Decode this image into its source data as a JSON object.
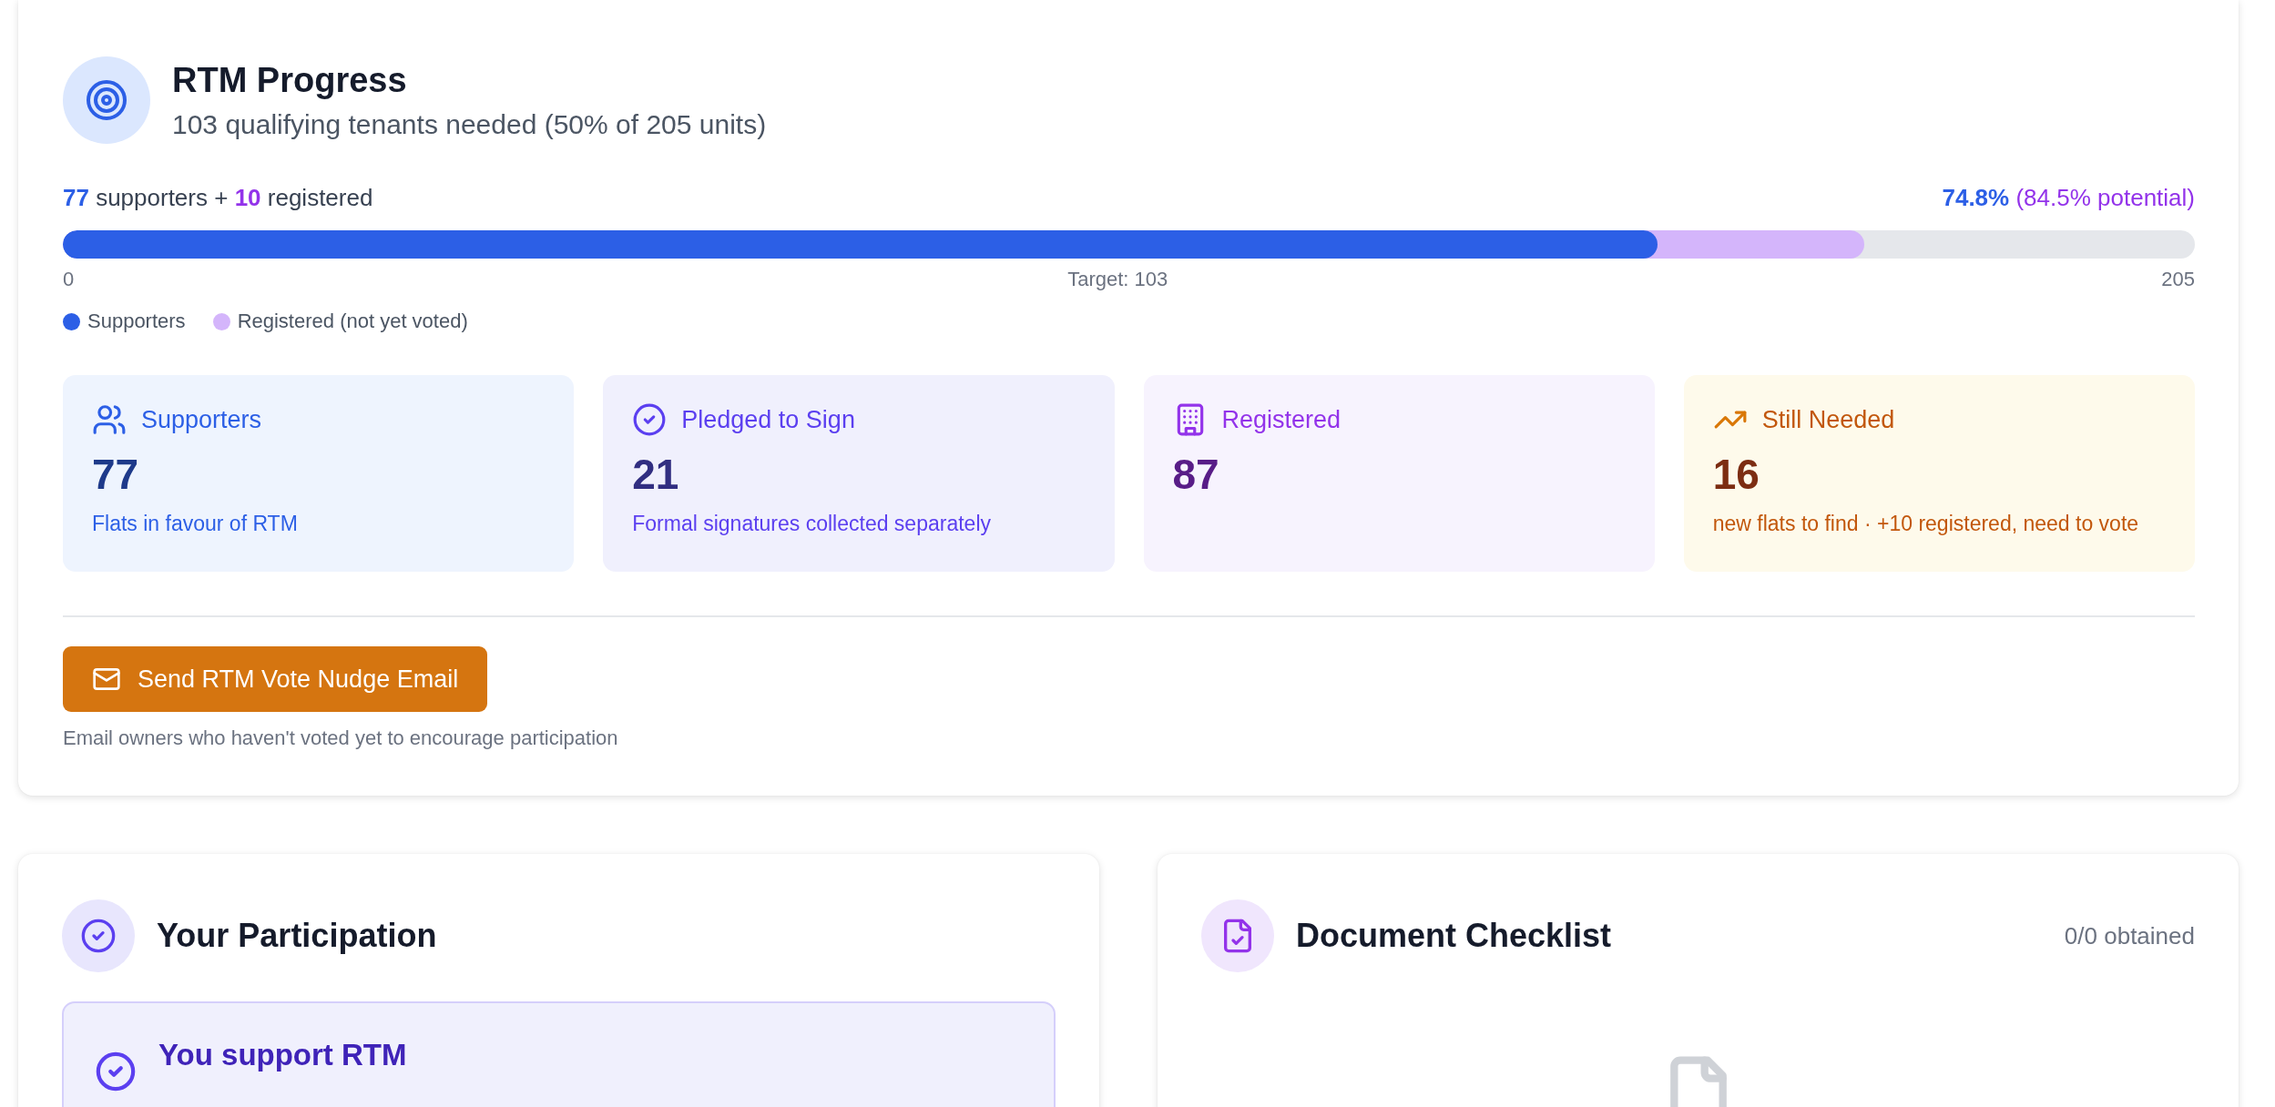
{
  "progress": {
    "title": "RTM Progress",
    "subtitle": "103 qualifying tenants needed (50% of 205 units)",
    "counts": "**77** supporters + **10** registered",
    "percent": "**74.8%** (84.5% potential)",
    "segments": [
      {
        "kind": "supporters",
        "level": 0.748
      },
      {
        "kind": "registered",
        "level": 0.845
      }
    ],
    "ticks": [
      "0",
      "Target: 103",
      "205"
    ],
    "legend": [
      {
        "label": "Supporters",
        "color": "#2c5fe6"
      },
      {
        "label": "Registered (not yet voted)",
        "color": "#d4b5fb"
      }
    ],
    "stats": [
      {
        "kind": "supporters",
        "title": "Supporters",
        "value": "77",
        "note": "Flats in favour of RTM"
      },
      {
        "kind": "pledged",
        "title": "Pledged to Sign",
        "value": "21",
        "note": "Formal signatures collected separately"
      },
      {
        "kind": "registered",
        "title": "Registered",
        "value": "87"
      },
      {
        "kind": "needed",
        "title": "Still Needed",
        "value": "16",
        "note": "new flats to find · +10 registered, need to vote"
      }
    ],
    "button": "Send RTM Vote Nudge Email",
    "button_note": "Email owners who haven't voted yet to encourage participation"
  },
  "participation": {
    "title": "Your Participation",
    "status": "You support RTM"
  },
  "documents": {
    "title": "Document Checklist",
    "count": "0/0 obtained"
  }
}
